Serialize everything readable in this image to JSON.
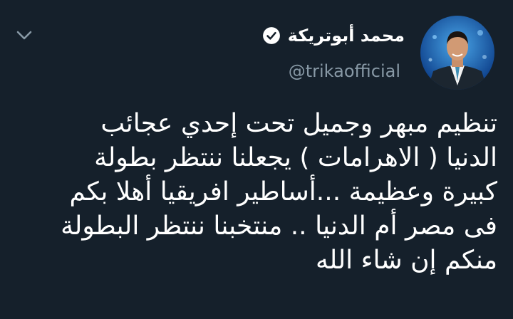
{
  "author": {
    "display_name": "محمد أبوتريكة",
    "handle": "@trikaofficial",
    "verified_icon": "verified-badge-icon"
  },
  "menu": {
    "icon": "chevron-down-icon"
  },
  "tweet": {
    "lines": [
      "تنظيم مبهر وجميل تحت إحدي عجائب",
      "الدنيا ( الاهرامات ) يجعلنا ننتظر بطولة",
      "كبيرة وعظيمة ...أساطير افريقيا أهلا بكم",
      "فى مصر أم الدنيا .. منتخبنا ننتظر البطولة",
      "منكم إن شاء الله"
    ]
  },
  "colors": {
    "background": "#15202b",
    "text": "#ffffff",
    "secondary_text": "#8899a6"
  }
}
